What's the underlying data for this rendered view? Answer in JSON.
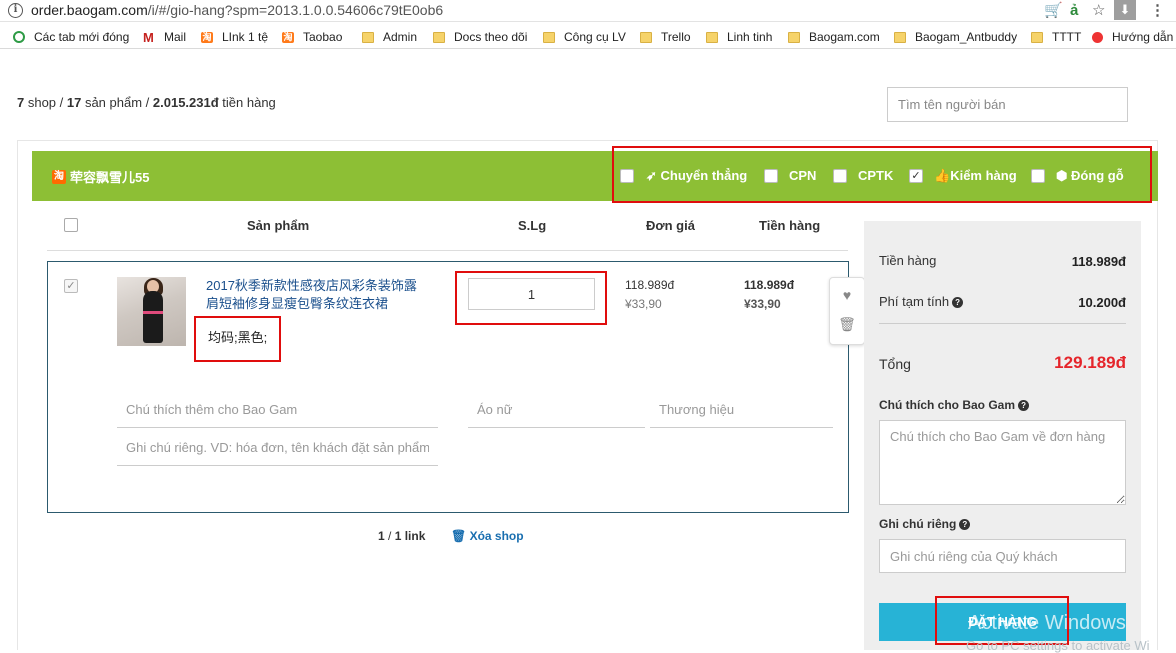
{
  "browser": {
    "url_domain": "order.baogam.com",
    "url_path": "/i/#/gio-hang?spm=2013.1.0.0.54606c79tE0ob6",
    "bookmarks": [
      "Các tab mới đóng",
      "Mail",
      "LInk 1 tệ",
      "Taobao",
      "Admin",
      "Docs theo dõi",
      "Công cụ LV",
      "Trello",
      "Linh tinh",
      "Baogam.com",
      "Baogam_Antbuddy",
      "TTTT",
      "Hướng dẫn"
    ]
  },
  "summary": {
    "shops": "7",
    "shop_label": " shop / ",
    "products": "17",
    "product_label": " sản phẩm / ",
    "amount": "2.015.231đ",
    "amount_label": " tiền hàng"
  },
  "seller_search": {
    "placeholder": "Tìm tên người bán"
  },
  "shop": {
    "name": "荦容飘雪儿55",
    "taobao_icon": "淘",
    "options": [
      {
        "label": "Chuyển thẳng",
        "icon": "rocket-icon",
        "checked": false
      },
      {
        "label": "CPN",
        "checked": false
      },
      {
        "label": "CPTK",
        "checked": false
      },
      {
        "label": "Kiểm hàng",
        "icon": "thumbs-up-icon",
        "checked": true
      },
      {
        "label": "Đóng gỗ",
        "icon": "box-icon",
        "checked": false
      }
    ],
    "columns": {
      "product": "Sản phẩm",
      "qty": "S.Lg",
      "unit_price": "Đơn giá",
      "total": "Tiền hàng"
    },
    "item": {
      "title": "2017秋季新款性感夜店风彩条装饰露肩短袖修身显瘦包臀条纹连衣裙",
      "variant": "均码;黑色;",
      "qty": "1",
      "unit_price_vnd": "118.989đ",
      "unit_price_cny": "¥33,90",
      "total_vnd": "118.989đ",
      "total_cny": "¥33,90",
      "note_placeholder": "Chú thích thêm cho Bao Gam",
      "category_placeholder": "Áo nữ",
      "brand_placeholder": "Thương hiệu",
      "private_note_placeholder": "Ghi chú riêng. VD: hóa đơn, tên khách đặt sản phẩm"
    },
    "pager": {
      "current": "1",
      "total": "1",
      "label": " link"
    },
    "delete_shop": "Xóa shop"
  },
  "sidebar": {
    "goods_label": "Tiền hàng",
    "goods_value": "118.989đ",
    "fee_label": "Phí tạm tính",
    "fee_value": "10.200đ",
    "total_label": "Tổng",
    "total_value": "129.189đ",
    "note_label": "Chú thích cho Bao Gam",
    "note_placeholder": "Chú thích cho Bao Gam về đơn hàng",
    "private_label": "Ghi chú riêng",
    "private_placeholder": "Ghi chú riêng của Quý khách",
    "order_button": "ĐẶT HÀNG"
  },
  "watermark": {
    "line1": "Activate Windows",
    "line2": "Go to PC settings to activate Wi"
  },
  "colors": {
    "shop_header": "#8dbf35",
    "order_button": "#27b3d6",
    "total": "#e5252b",
    "highlight": "#e00d0d",
    "link": "#1a4f8c"
  }
}
